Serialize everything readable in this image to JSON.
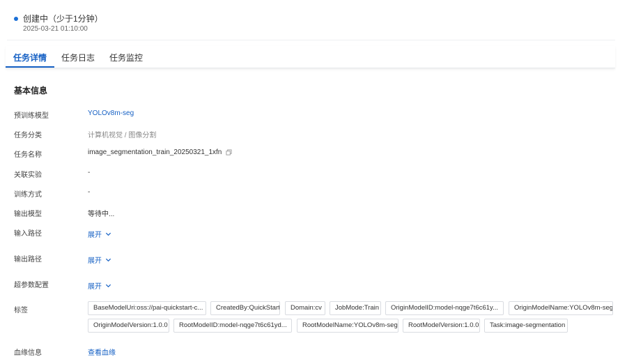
{
  "status": {
    "label": "创建中（少于1分钟）",
    "time": "2025-03-21 01:10:00",
    "dot_color": "#1a6fd6"
  },
  "tabs": [
    {
      "label": "任务详情"
    },
    {
      "label": "任务日志"
    },
    {
      "label": "任务监控"
    }
  ],
  "section": {
    "title": "基本信息"
  },
  "fields": {
    "pretrained_model": {
      "label": "预训练模型",
      "value": "YOLOv8m-seg"
    },
    "task_category": {
      "label": "任务分类",
      "value": "计算机视觉 / 图像分割"
    },
    "task_name": {
      "label": "任务名称",
      "value": "image_segmentation_train_20250321_1xfn"
    },
    "experiment": {
      "label": "关联实验",
      "value": "-"
    },
    "training_mode": {
      "label": "训练方式",
      "value": "-"
    },
    "output_model": {
      "label": "输出模型",
      "value": "等待中..."
    },
    "input_path": {
      "label": "输入路径",
      "value": "展开"
    },
    "output_path": {
      "label": "输出路径",
      "value": "展开"
    },
    "hyperparams": {
      "label": "超参数配置",
      "value": "展开"
    },
    "tags": {
      "label": "标签"
    },
    "lineage": {
      "label": "血缘信息",
      "value": "查看血缘"
    }
  },
  "tags": [
    "BaseModelUri:oss://pai-quickstart-c...",
    "CreatedBy:QuickStart",
    "Domain:cv",
    "JobMode:Train",
    "OriginModelID:model-nqge7t6c61y...",
    "OriginModelName:YOLOv8m-seg",
    "OriginModelVersion:1.0.0",
    "RootModelID:model-nqge7t6c61yd...",
    "RootModelName:YOLOv8m-seg",
    "RootModelVersion:1.0.0",
    "Task:image-segmentation"
  ],
  "colors": {
    "link": "#1560c4",
    "accent": "#1560c4"
  }
}
